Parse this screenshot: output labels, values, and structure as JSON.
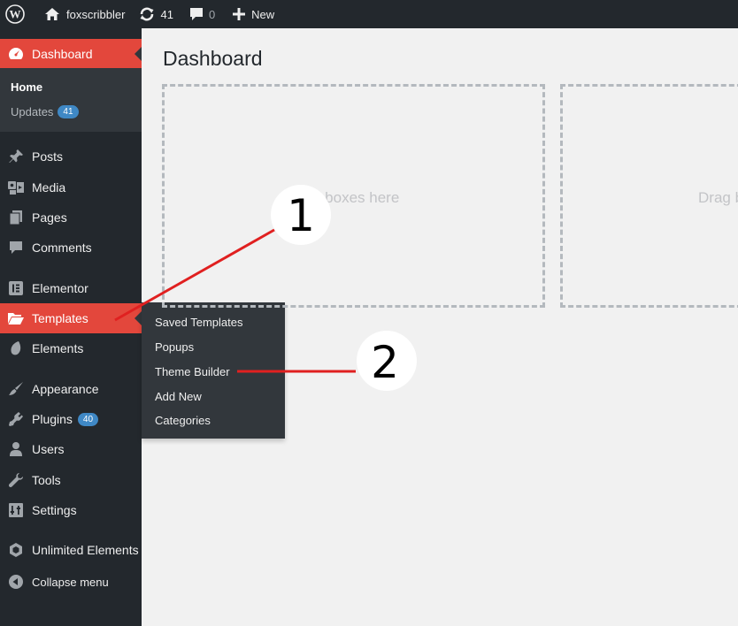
{
  "adminbar": {
    "site_name": "foxscribbler",
    "updates_count": "41",
    "comments_count": "0",
    "new_label": "New"
  },
  "sidebar": {
    "dashboard": "Dashboard",
    "dashboard_sub": {
      "home": "Home",
      "updates": "Updates",
      "updates_badge": "41"
    },
    "items": [
      {
        "label": "Posts",
        "icon": "pin-icon"
      },
      {
        "label": "Media",
        "icon": "media-icon"
      },
      {
        "label": "Pages",
        "icon": "pages-icon"
      },
      {
        "label": "Comments",
        "icon": "comment-icon"
      },
      {
        "label": "Elementor",
        "icon": "elementor-icon"
      },
      {
        "label": "Templates",
        "icon": "folder-icon"
      },
      {
        "label": "Elements",
        "icon": "elements-icon"
      },
      {
        "label": "Appearance",
        "icon": "brush-icon"
      },
      {
        "label": "Plugins",
        "icon": "plugin-icon",
        "badge": "40"
      },
      {
        "label": "Users",
        "icon": "user-icon"
      },
      {
        "label": "Tools",
        "icon": "wrench-icon"
      },
      {
        "label": "Settings",
        "icon": "settings-icon"
      },
      {
        "label": "Unlimited Elements",
        "icon": "unlimited-icon"
      },
      {
        "label": "Collapse menu",
        "icon": "collapse-icon"
      }
    ]
  },
  "flyout": [
    "Saved Templates",
    "Popups",
    "Theme Builder",
    "Add New",
    "Categories"
  ],
  "main": {
    "title": "Dashboard",
    "drop_text_1": "n boxes here",
    "drop_text_2": "Drag b"
  },
  "annotations": {
    "marker_1": "1",
    "marker_2": "2"
  },
  "colors": {
    "accent": "#e3473c",
    "sidebar_bg": "#23282d",
    "submenu_bg": "#32373c",
    "annotation_red": "#e02020"
  }
}
